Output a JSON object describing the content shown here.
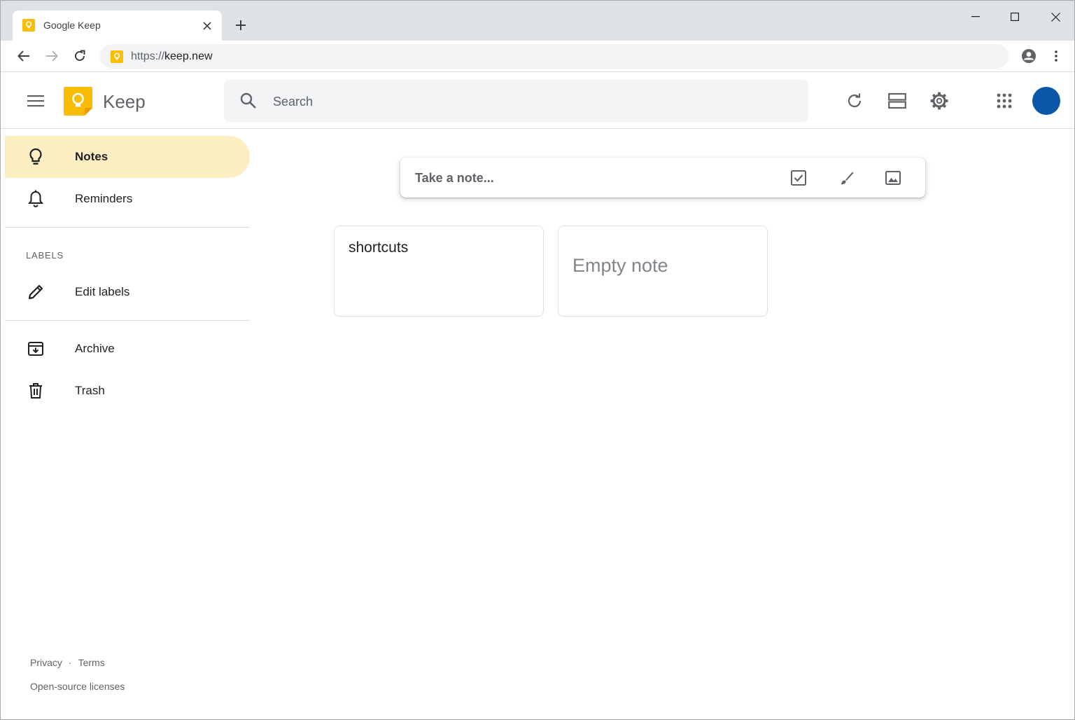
{
  "browser": {
    "tab_title": "Google Keep",
    "url_scheme": "https://",
    "url_host": "keep.new"
  },
  "header": {
    "app_name": "Keep",
    "search_placeholder": "Search"
  },
  "sidebar": {
    "items": [
      {
        "label": "Notes",
        "icon": "lightbulb-icon",
        "active": true
      },
      {
        "label": "Reminders",
        "icon": "bell-icon"
      },
      {
        "label": "Edit labels",
        "icon": "pencil-icon"
      },
      {
        "label": "Archive",
        "icon": "archive-icon"
      },
      {
        "label": "Trash",
        "icon": "trash-icon"
      }
    ],
    "labels_heading": "LABELS",
    "footer": {
      "privacy": "Privacy",
      "separator": "·",
      "terms": "Terms",
      "licenses": "Open-source licenses"
    }
  },
  "main": {
    "take_note_placeholder": "Take a note...",
    "notes": [
      {
        "title": "shortcuts"
      },
      {
        "placeholder": "Empty note"
      }
    ]
  },
  "colors": {
    "accent": "#fbbc04",
    "active_bg": "#feefc3",
    "avatar": "#0b57a7"
  }
}
